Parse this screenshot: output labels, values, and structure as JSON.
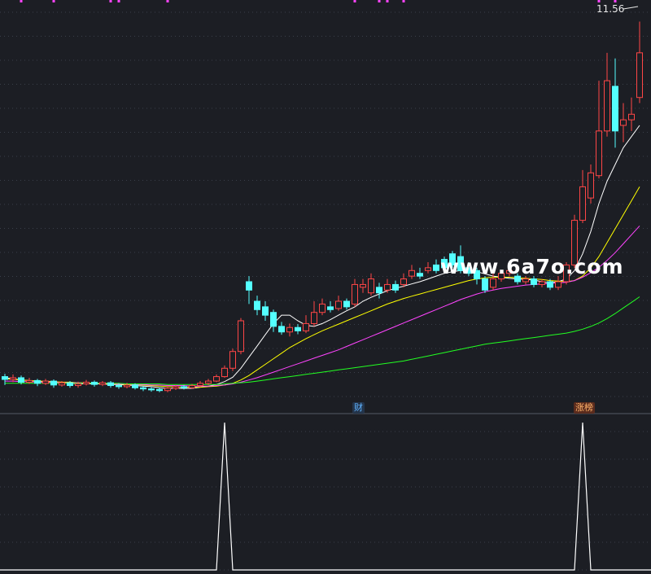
{
  "price_label": "11.56",
  "badges": {
    "cai": "财",
    "zhangbang": "涨榜"
  },
  "watermark": "www.6a7o.com",
  "colors": {
    "background": "#1c1e24",
    "grid": "#3a3f4a",
    "up": "#ff4646",
    "down": "#54ffff",
    "ma_fast": "#ffffff",
    "ma_mid": "#ffff00",
    "ma_slow": "#ff44ff",
    "ma_long": "#22ff22",
    "markers": "#ff44ff",
    "indicator": "#ffffff"
  },
  "chart_data": [
    {
      "type": "candlestick",
      "title": "",
      "price_max_label": 11.56,
      "candles": [
        {
          "o": 5.2,
          "c": 5.15,
          "h": 5.25,
          "l": 5.05
        },
        {
          "o": 5.15,
          "c": 5.18,
          "h": 5.24,
          "l": 5.1
        },
        {
          "o": 5.18,
          "c": 5.1,
          "h": 5.22,
          "l": 5.06
        },
        {
          "o": 5.1,
          "c": 5.13,
          "h": 5.18,
          "l": 5.07
        },
        {
          "o": 5.13,
          "c": 5.08,
          "h": 5.16,
          "l": 5.03
        },
        {
          "o": 5.08,
          "c": 5.12,
          "h": 5.16,
          "l": 5.05
        },
        {
          "o": 5.12,
          "c": 5.05,
          "h": 5.15,
          "l": 5.0
        },
        {
          "o": 5.05,
          "c": 5.09,
          "h": 5.12,
          "l": 5.02
        },
        {
          "o": 5.09,
          "c": 5.04,
          "h": 5.12,
          "l": 5.0
        },
        {
          "o": 5.04,
          "c": 5.07,
          "h": 5.11,
          "l": 5.0
        },
        {
          "o": 5.07,
          "c": 5.1,
          "h": 5.14,
          "l": 5.04
        },
        {
          "o": 5.1,
          "c": 5.06,
          "h": 5.13,
          "l": 5.02
        },
        {
          "o": 5.06,
          "c": 5.09,
          "h": 5.12,
          "l": 5.03
        },
        {
          "o": 5.09,
          "c": 5.04,
          "h": 5.12,
          "l": 5.0
        },
        {
          "o": 5.04,
          "c": 5.02,
          "h": 5.08,
          "l": 4.98
        },
        {
          "o": 5.02,
          "c": 5.05,
          "h": 5.09,
          "l": 4.99
        },
        {
          "o": 5.05,
          "c": 5.0,
          "h": 5.08,
          "l": 4.97
        },
        {
          "o": 5.0,
          "c": 4.98,
          "h": 5.03,
          "l": 4.94
        },
        {
          "o": 4.98,
          "c": 4.97,
          "h": 5.01,
          "l": 4.93
        },
        {
          "o": 4.97,
          "c": 4.95,
          "h": 5.0,
          "l": 4.92
        },
        {
          "o": 4.95,
          "c": 4.99,
          "h": 5.03,
          "l": 4.92
        },
        {
          "o": 4.99,
          "c": 5.02,
          "h": 5.05,
          "l": 4.96
        },
        {
          "o": 5.02,
          "c": 5.0,
          "h": 5.05,
          "l": 4.97
        },
        {
          "o": 5.0,
          "c": 5.04,
          "h": 5.07,
          "l": 4.98
        },
        {
          "o": 5.04,
          "c": 5.08,
          "h": 5.12,
          "l": 5.01
        },
        {
          "o": 5.08,
          "c": 5.12,
          "h": 5.16,
          "l": 5.05
        },
        {
          "o": 5.12,
          "c": 5.2,
          "h": 5.24,
          "l": 5.1
        },
        {
          "o": 5.2,
          "c": 5.35,
          "h": 5.4,
          "l": 5.18
        },
        {
          "o": 5.35,
          "c": 5.65,
          "h": 5.7,
          "l": 5.3
        },
        {
          "o": 5.65,
          "c": 6.2,
          "h": 6.25,
          "l": 5.6
        },
        {
          "o": 6.9,
          "c": 6.75,
          "h": 7.0,
          "l": 6.5
        },
        {
          "o": 6.55,
          "c": 6.4,
          "h": 6.65,
          "l": 6.3
        },
        {
          "o": 6.45,
          "c": 6.3,
          "h": 6.55,
          "l": 6.2
        },
        {
          "o": 6.35,
          "c": 6.1,
          "h": 6.4,
          "l": 6.0
        },
        {
          "o": 6.1,
          "c": 6.0,
          "h": 6.18,
          "l": 5.95
        },
        {
          "o": 6.0,
          "c": 6.08,
          "h": 6.15,
          "l": 5.92
        },
        {
          "o": 6.08,
          "c": 6.02,
          "h": 6.14,
          "l": 5.96
        },
        {
          "o": 6.02,
          "c": 6.15,
          "h": 6.3,
          "l": 5.98
        },
        {
          "o": 6.15,
          "c": 6.35,
          "h": 6.55,
          "l": 6.1
        },
        {
          "o": 6.35,
          "c": 6.5,
          "h": 6.6,
          "l": 6.3
        },
        {
          "o": 6.45,
          "c": 6.4,
          "h": 6.55,
          "l": 6.35
        },
        {
          "o": 6.42,
          "c": 6.55,
          "h": 6.65,
          "l": 6.38
        },
        {
          "o": 6.55,
          "c": 6.45,
          "h": 6.6,
          "l": 6.4
        },
        {
          "o": 6.5,
          "c": 6.85,
          "h": 6.95,
          "l": 6.45
        },
        {
          "o": 6.8,
          "c": 6.85,
          "h": 6.95,
          "l": 6.7
        },
        {
          "o": 6.7,
          "c": 6.95,
          "h": 7.05,
          "l": 6.65
        },
        {
          "o": 6.8,
          "c": 6.7,
          "h": 6.88,
          "l": 6.6
        },
        {
          "o": 6.75,
          "c": 6.85,
          "h": 6.95,
          "l": 6.7
        },
        {
          "o": 6.85,
          "c": 6.75,
          "h": 6.92,
          "l": 6.7
        },
        {
          "o": 6.85,
          "c": 6.95,
          "h": 7.05,
          "l": 6.8
        },
        {
          "o": 7.0,
          "c": 7.1,
          "h": 7.2,
          "l": 6.95
        },
        {
          "o": 7.05,
          "c": 7.0,
          "h": 7.15,
          "l": 6.95
        },
        {
          "o": 7.1,
          "c": 7.15,
          "h": 7.25,
          "l": 7.05
        },
        {
          "o": 7.2,
          "c": 7.1,
          "h": 7.3,
          "l": 7.05
        },
        {
          "o": 7.3,
          "c": 7.15,
          "h": 7.35,
          "l": 7.1
        },
        {
          "o": 7.4,
          "c": 7.2,
          "h": 7.45,
          "l": 7.15
        },
        {
          "o": 7.35,
          "c": 7.1,
          "h": 7.55,
          "l": 7.05
        },
        {
          "o": 7.15,
          "c": 7.05,
          "h": 7.25,
          "l": 7.0
        },
        {
          "o": 7.1,
          "c": 6.95,
          "h": 7.15,
          "l": 6.85
        },
        {
          "o": 6.95,
          "c": 6.75,
          "h": 7.0,
          "l": 6.7
        },
        {
          "o": 6.8,
          "c": 6.95,
          "h": 7.05,
          "l": 6.75
        },
        {
          "o": 6.95,
          "c": 7.05,
          "h": 7.1,
          "l": 6.9
        },
        {
          "o": 7.05,
          "c": 7.1,
          "h": 7.15,
          "l": 7.0
        },
        {
          "o": 7.0,
          "c": 6.9,
          "h": 7.05,
          "l": 6.85
        },
        {
          "o": 6.9,
          "c": 6.95,
          "h": 7.0,
          "l": 6.85
        },
        {
          "o": 6.95,
          "c": 6.85,
          "h": 7.0,
          "l": 6.8
        },
        {
          "o": 6.85,
          "c": 6.9,
          "h": 6.95,
          "l": 6.8
        },
        {
          "o": 6.9,
          "c": 6.8,
          "h": 6.95,
          "l": 6.75
        },
        {
          "o": 6.8,
          "c": 6.9,
          "h": 7.0,
          "l": 6.75
        },
        {
          "o": 6.9,
          "c": 7.2,
          "h": 7.25,
          "l": 6.85
        },
        {
          "o": 7.2,
          "c": 8.0,
          "h": 8.1,
          "l": 7.15
        },
        {
          "o": 8.0,
          "c": 8.6,
          "h": 8.9,
          "l": 7.95
        },
        {
          "o": 8.4,
          "c": 8.85,
          "h": 9.0,
          "l": 8.3
        },
        {
          "o": 8.8,
          "c": 9.6,
          "h": 10.5,
          "l": 8.75
        },
        {
          "o": 9.6,
          "c": 10.5,
          "h": 11.0,
          "l": 9.5
        },
        {
          "o": 10.4,
          "c": 9.6,
          "h": 10.9,
          "l": 9.3
        },
        {
          "o": 9.7,
          "c": 9.8,
          "h": 10.1,
          "l": 9.4
        },
        {
          "o": 9.8,
          "c": 9.9,
          "h": 10.2,
          "l": 9.6
        },
        {
          "o": 10.2,
          "c": 11.0,
          "h": 11.56,
          "l": 10.1
        }
      ],
      "moving_averages": [
        {
          "name": "",
          "color": "#ffffff",
          "values": [
            5.18,
            5.16,
            5.14,
            5.13,
            5.12,
            5.11,
            5.1,
            5.09,
            5.08,
            5.07,
            5.07,
            5.07,
            5.07,
            5.06,
            5.06,
            5.05,
            5.04,
            5.03,
            5.02,
            5.0,
            4.99,
            4.99,
            4.99,
            4.99,
            5.01,
            5.03,
            5.06,
            5.11,
            5.19,
            5.35,
            5.55,
            5.75,
            5.95,
            6.15,
            6.3,
            6.3,
            6.2,
            6.12,
            6.1,
            6.15,
            6.22,
            6.3,
            6.38,
            6.45,
            6.55,
            6.62,
            6.68,
            6.74,
            6.78,
            6.82,
            6.86,
            6.9,
            6.95,
            7.0,
            7.05,
            7.08,
            7.1,
            7.1,
            7.08,
            7.04,
            7.0,
            6.98,
            6.96,
            6.95,
            6.94,
            6.93,
            6.9,
            6.88,
            6.9,
            6.95,
            7.1,
            7.4,
            7.8,
            8.3,
            8.7,
            9.0,
            9.3,
            9.5,
            9.7
          ]
        },
        {
          "name": "",
          "color": "#ffff00",
          "values": [
            5.16,
            5.15,
            5.14,
            5.13,
            5.12,
            5.12,
            5.11,
            5.1,
            5.1,
            5.09,
            5.09,
            5.08,
            5.08,
            5.07,
            5.07,
            5.06,
            5.06,
            5.05,
            5.04,
            5.03,
            5.02,
            5.02,
            5.01,
            5.01,
            5.01,
            5.02,
            5.03,
            5.05,
            5.08,
            5.14,
            5.22,
            5.32,
            5.42,
            5.52,
            5.62,
            5.72,
            5.8,
            5.88,
            5.95,
            6.02,
            6.08,
            6.14,
            6.2,
            6.26,
            6.32,
            6.38,
            6.44,
            6.5,
            6.55,
            6.6,
            6.64,
            6.68,
            6.72,
            6.76,
            6.8,
            6.84,
            6.88,
            6.92,
            6.95,
            6.97,
            6.98,
            6.98,
            6.98,
            6.97,
            6.96,
            6.95,
            6.94,
            6.92,
            6.91,
            6.9,
            6.92,
            7.0,
            7.15,
            7.35,
            7.6,
            7.85,
            8.1,
            8.35,
            8.6
          ]
        },
        {
          "name": "",
          "color": "#ff44ff",
          "values": [
            5.12,
            5.12,
            5.11,
            5.11,
            5.1,
            5.1,
            5.1,
            5.09,
            5.09,
            5.09,
            5.08,
            5.08,
            5.08,
            5.08,
            5.07,
            5.07,
            5.06,
            5.06,
            5.05,
            5.05,
            5.04,
            5.04,
            5.04,
            5.03,
            5.03,
            5.03,
            5.04,
            5.05,
            5.07,
            5.1,
            5.14,
            5.18,
            5.23,
            5.28,
            5.33,
            5.38,
            5.43,
            5.48,
            5.53,
            5.58,
            5.63,
            5.68,
            5.74,
            5.8,
            5.86,
            5.92,
            5.98,
            6.04,
            6.1,
            6.16,
            6.22,
            6.28,
            6.34,
            6.4,
            6.46,
            6.52,
            6.58,
            6.63,
            6.68,
            6.72,
            6.75,
            6.78,
            6.8,
            6.82,
            6.84,
            6.85,
            6.86,
            6.87,
            6.88,
            6.89,
            6.92,
            6.98,
            7.06,
            7.16,
            7.28,
            7.42,
            7.58,
            7.74,
            7.9
          ]
        },
        {
          "name": "",
          "color": "#22ff22",
          "values": [
            5.08,
            5.08,
            5.08,
            5.08,
            5.08,
            5.08,
            5.08,
            5.08,
            5.08,
            5.08,
            5.08,
            5.08,
            5.08,
            5.08,
            5.08,
            5.07,
            5.07,
            5.07,
            5.07,
            5.07,
            5.06,
            5.06,
            5.06,
            5.06,
            5.06,
            5.06,
            5.06,
            5.07,
            5.08,
            5.09,
            5.1,
            5.12,
            5.14,
            5.16,
            5.18,
            5.2,
            5.22,
            5.24,
            5.26,
            5.28,
            5.3,
            5.32,
            5.34,
            5.36,
            5.38,
            5.4,
            5.42,
            5.44,
            5.46,
            5.48,
            5.51,
            5.54,
            5.57,
            5.6,
            5.63,
            5.66,
            5.69,
            5.72,
            5.75,
            5.78,
            5.8,
            5.82,
            5.84,
            5.86,
            5.88,
            5.9,
            5.92,
            5.94,
            5.96,
            5.98,
            6.01,
            6.05,
            6.1,
            6.16,
            6.24,
            6.33,
            6.43,
            6.53,
            6.63
          ]
        }
      ],
      "ylim": [
        4.8,
        11.8
      ],
      "grid": true,
      "top_markers": [
        2,
        6,
        13,
        14,
        20,
        43,
        46,
        47,
        49,
        73,
        75
      ]
    },
    {
      "type": "line",
      "title": "",
      "values_note": "",
      "values": [
        0,
        0,
        0,
        0,
        0,
        0,
        0,
        0,
        0,
        0,
        0,
        0,
        0,
        0,
        0,
        0,
        0,
        0,
        0,
        0,
        0,
        0,
        0,
        0,
        0,
        0,
        0,
        1,
        0,
        0,
        0,
        0,
        0,
        0,
        0,
        0,
        0,
        0,
        0,
        0,
        0,
        0,
        0,
        0,
        0,
        0,
        0,
        0,
        0,
        0,
        0,
        0,
        0,
        0,
        0,
        0,
        0,
        0,
        0,
        0,
        0,
        0,
        0,
        0,
        0,
        0,
        0,
        0,
        0,
        0,
        0,
        1,
        0,
        0,
        0,
        0,
        0,
        0,
        0
      ],
      "ylim": [
        0,
        1.05
      ],
      "grid": true
    }
  ]
}
